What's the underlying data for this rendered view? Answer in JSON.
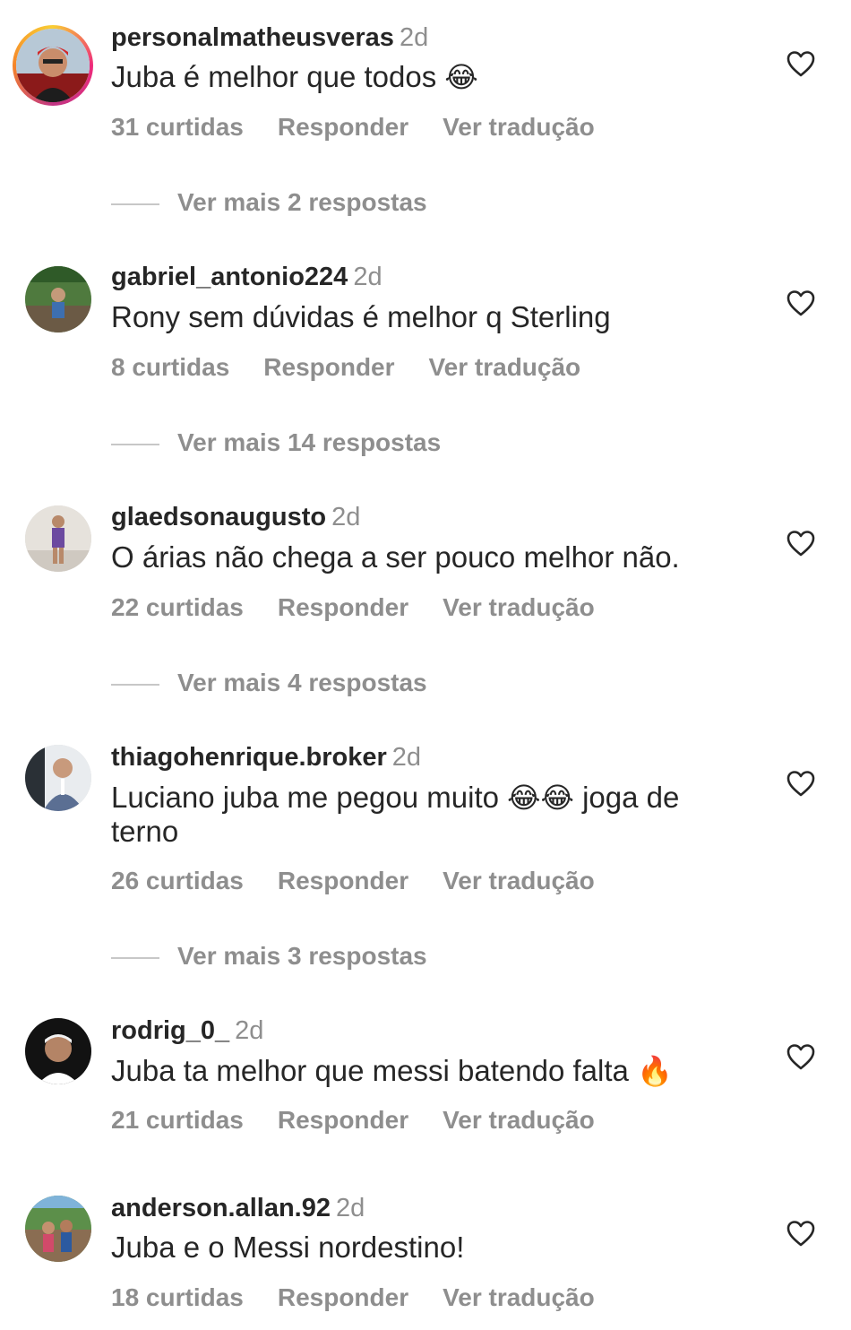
{
  "comments": [
    {
      "username": "personalmatheusveras",
      "time": "2d",
      "text": "Juba é melhor que todos",
      "emoji": "😂",
      "likes": "31 curtidas",
      "reply": "Responder",
      "translate": "Ver tradução",
      "more_replies": "Ver mais 2 respostas",
      "has_story_ring": true
    },
    {
      "username": "gabriel_antonio224",
      "time": "2d",
      "text": "Rony sem dúvidas é melhor q Sterling",
      "likes": "8 curtidas",
      "reply": "Responder",
      "translate": "Ver tradução",
      "more_replies": "Ver mais 14 respostas"
    },
    {
      "username": "glaedsonaugusto",
      "time": "2d",
      "text": "O árias não chega a ser pouco melhor não.",
      "likes": "22 curtidas",
      "reply": "Responder",
      "translate": "Ver tradução",
      "more_replies": "Ver mais 4 respostas"
    },
    {
      "username": "thiagohenrique.broker",
      "time": "2d",
      "text": "Luciano juba me pegou muito",
      "emoji": "😂😂",
      "text_after": "joga de terno",
      "likes": "26 curtidas",
      "reply": "Responder",
      "translate": "Ver tradução",
      "more_replies": "Ver mais 3 respostas"
    },
    {
      "username": "rodrig_0_",
      "time": "2d",
      "text": "Juba ta melhor que messi batendo falta",
      "emoji": "🔥",
      "likes": "21 curtidas",
      "reply": "Responder",
      "translate": "Ver tradução"
    },
    {
      "username": "anderson.allan.92",
      "time": "2d",
      "text": "Juba e o Messi nordestino!",
      "likes": "18 curtidas",
      "reply": "Responder",
      "translate": "Ver tradução"
    }
  ],
  "icons": {
    "like": "heart-outline-icon"
  },
  "colors": {
    "text": "#262626",
    "secondary": "#8e8e8e",
    "divider": "#c7c7c7"
  }
}
